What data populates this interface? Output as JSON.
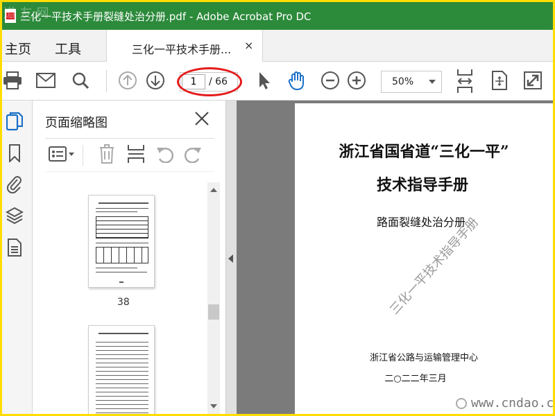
{
  "window": {
    "title": "三化一平技术手册裂缝处治分册.pdf - Adobe Acrobat Pro DC",
    "corner_watermark": "道 友 网"
  },
  "tabs": {
    "home": "主页",
    "tools": "工具",
    "document": "三化一平技术手册...",
    "close": "×"
  },
  "toolbar": {
    "page_current": "1",
    "page_total": "/ 66",
    "zoom": "50%",
    "icons": [
      "print-icon",
      "mail-icon",
      "search-icon",
      "page-up-icon",
      "page-down-icon",
      "select-cursor-icon",
      "hand-tool-icon",
      "zoom-out-icon",
      "zoom-in-icon",
      "fit-width-icon",
      "fit-page-icon",
      "fullscreen-icon"
    ],
    "highlight_color": "#e41b1b"
  },
  "sidebar": {
    "icons": [
      "page-thumbnails-icon",
      "bookmark-icon",
      "attachment-icon",
      "layers-icon",
      "document-properties-icon"
    ]
  },
  "thumbnails": {
    "title": "页面缩略图",
    "close": "×",
    "pages": [
      {
        "label": "38"
      }
    ]
  },
  "document": {
    "title_line1": "浙江省国省道“三化一平”",
    "title_line2": "技术指导手册",
    "subtitle": "路面裂缝处治分册",
    "watermark": "三化一平技术指导手册",
    "organization": "浙江省公路与运输管理中心",
    "date": "二○二二年三月"
  },
  "site_watermark": "www.cndao.com",
  "colors": {
    "titlebar": "#2c8a3b",
    "frame": "#ffdd00",
    "accent_blue": "#1a6fc7"
  }
}
